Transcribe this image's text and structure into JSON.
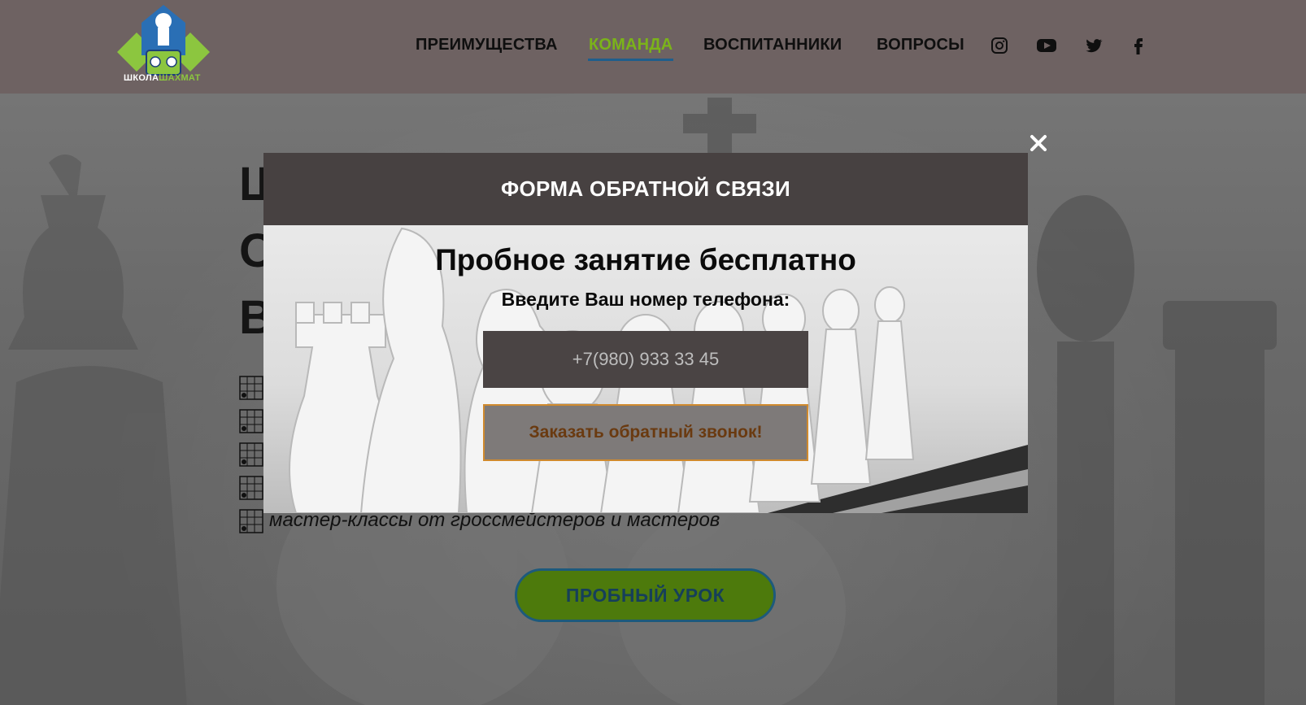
{
  "header": {
    "logo": {
      "word1": "ШКОЛА",
      "word2": "ШАХМАТ",
      "brand_green": "#8cc63f",
      "brand_blue": "#2a6fb5"
    },
    "nav": [
      {
        "label": "ПРЕИМУЩЕСТВА",
        "active": false
      },
      {
        "label": "КОМАНДА",
        "active": true
      },
      {
        "label": "ВОСПИТАННИКИ",
        "active": false
      },
      {
        "label": "ВОПРОСЫ",
        "active": false
      }
    ],
    "social": [
      "instagram-icon",
      "youtube-icon",
      "twitter-icon",
      "facebook-icon"
    ]
  },
  "hero": {
    "title_fragments": [
      "Ш",
      "О",
      "В"
    ],
    "features_visible_text": "мастер-классы от гроссмейстеров и мастеров",
    "trial_button": "ПРОБНЫЙ УРОК"
  },
  "modal": {
    "header": "ФОРМА ОБРАТНОЙ СВЯЗИ",
    "title": "Пробное занятие бесплатно",
    "subtitle": "Введите Ваш номер телефона:",
    "phone_placeholder": "+7(980) 933 33 45",
    "submit": "Заказать обратный звонок!",
    "close": "close-icon"
  },
  "colors": {
    "header_bg": "#6e6262",
    "modal_header_bg": "#474141",
    "nav_active": "#7bb31a",
    "nav_underline": "#1f5e8c",
    "submit_border": "#d08a2e",
    "trial_bg": "#4d7a0c"
  }
}
